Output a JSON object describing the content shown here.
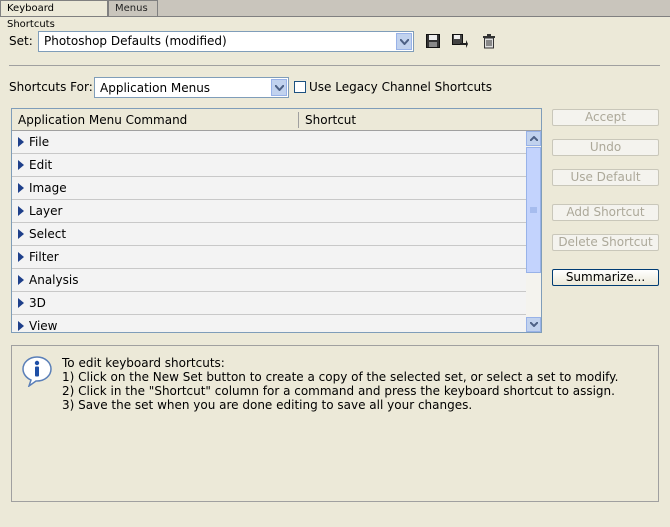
{
  "tabs": [
    {
      "label": "Keyboard Shortcuts",
      "active": true
    },
    {
      "label": "Menus",
      "active": false
    }
  ],
  "set": {
    "label": "Set:",
    "value": "Photoshop Defaults (modified)",
    "icons": [
      "save-set-icon",
      "new-set-icon",
      "delete-set-icon"
    ]
  },
  "shortcuts_for": {
    "label": "Shortcuts For:",
    "value": "Application Menus",
    "legacy_checkbox_label": "Use Legacy Channel Shortcuts",
    "legacy_checked": false
  },
  "table": {
    "columns": [
      "Application Menu Command",
      "Shortcut"
    ],
    "rows": [
      "File",
      "Edit",
      "Image",
      "Layer",
      "Select",
      "Filter",
      "Analysis",
      "3D",
      "View"
    ]
  },
  "buttons": {
    "accept": "Accept",
    "undo": "Undo",
    "use_default": "Use Default",
    "add_shortcut": "Add Shortcut",
    "delete_shortcut": "Delete Shortcut",
    "summarize": "Summarize..."
  },
  "info": {
    "icon": "info-icon",
    "lines": [
      "To edit keyboard shortcuts:",
      "1) Click on the New Set button to create a copy of the selected set, or select a set to modify.",
      "2) Click in the \"Shortcut\" column for a command and press the keyboard shortcut to assign.",
      "3) Save the set when you are done editing to save all your changes."
    ]
  },
  "colors": {
    "panel_bg": "#ece9d8",
    "field_border": "#7f9db9",
    "expand_triangle": "#1e3f8a"
  }
}
